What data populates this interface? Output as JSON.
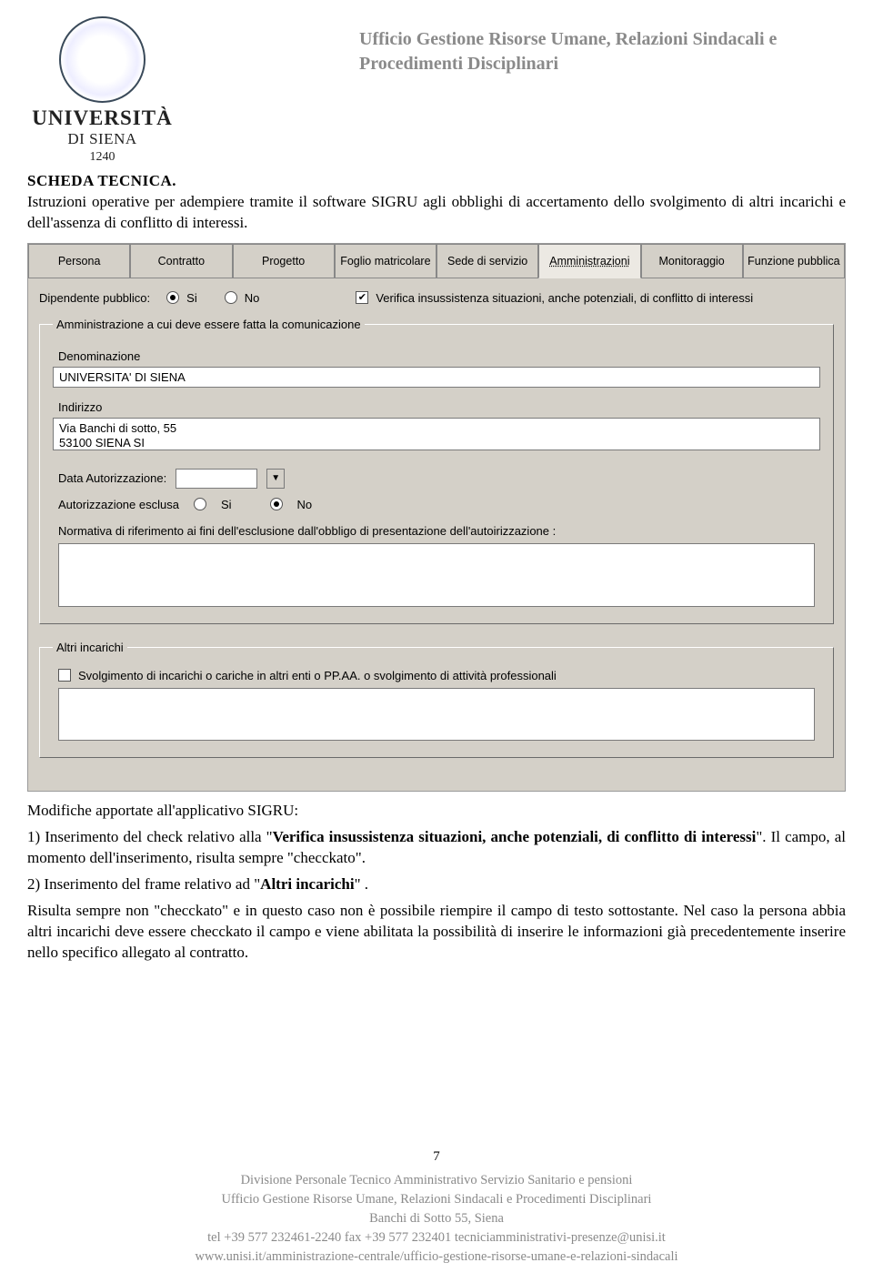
{
  "header": {
    "logo_uni": "UNIVERSITÀ",
    "logo_di_siena": "DI SIENA",
    "logo_year": "1240",
    "office_title": "Ufficio Gestione Risorse Umane, Relazioni Sindacali e Procedimenti Disciplinari"
  },
  "doc": {
    "scheda": "SCHEDA TECNICA.",
    "intro": "Istruzioni operative per adempiere tramite il software SIGRU agli obblighi di accertamento dello svolgimento di altri incarichi e dell'assenza di conflitto di interessi."
  },
  "app": {
    "tabs": [
      {
        "label": "Persona"
      },
      {
        "label": "Contratto"
      },
      {
        "label": "Progetto"
      },
      {
        "label": "Foglio matricolare"
      },
      {
        "label": "Sede di servizio"
      },
      {
        "label": "Amministrazioni"
      },
      {
        "label": "Monitoraggio"
      },
      {
        "label": "Funzione pubblica"
      }
    ],
    "dip_pubblico_label": "Dipendente pubblico:",
    "si": "Si",
    "no": "No",
    "verifica_label": "Verifica insussistenza situazioni, anche potenziali, di conflitto di interessi",
    "fieldset_admin": "Amministrazione a cui deve essere fatta la comunicazione",
    "denominazione_label": "Denominazione",
    "denominazione_value": "UNIVERSITA' DI SIENA",
    "indirizzo_label": "Indirizzo",
    "indirizzo_value": "Via Banchi di sotto, 55\n53100 SIENA SI",
    "data_auth_label": "Data Autorizzazione:",
    "auth_esclusa_label": "Autorizzazione esclusa",
    "norma_label": "Normativa di riferimento ai fini dell'esclusione dall'obbligo di presentazione dell'autoirizzazione :",
    "fieldset_altri": "Altri incarichi",
    "altri_check_label": "Svolgimento di incarichi o cariche in altri enti o PP.AA. o svolgimento di attività professionali"
  },
  "after": {
    "modifiche": "Modifiche apportate all'applicativo SIGRU:",
    "p1_a": "1) Inserimento del check relativo alla \"",
    "p1_bold": "Verifica insussistenza situazioni, anche potenziali, di conflitto di interessi",
    "p1_b": "\". Il campo, al momento dell'inserimento, risulta sempre \"checckato\".",
    "p2_a": "2) Inserimento del frame relativo ad \"",
    "p2_bold": "Altri incarichi",
    "p2_b": "\" .",
    "p3": "Risulta sempre non \"checckato\" e in questo caso non è possibile riempire il campo di testo sottostante. Nel caso la persona abbia altri incarichi deve essere checckato il campo e viene abilitata la possibilità di inserire le informazioni già precedentemente inserire nello specifico allegato al contratto."
  },
  "footer": {
    "page": "7",
    "l1": "Divisione Personale Tecnico Amministrativo Servizio Sanitario e pensioni",
    "l2": "Ufficio Gestione Risorse Umane, Relazioni Sindacali e Procedimenti Disciplinari",
    "l3": "Banchi di Sotto 55, Siena",
    "l4": "tel +39 577 232461-2240  fax +39 577 232401  tecniciamministrativi-presenze@unisi.it",
    "l5": "www.unisi.it/amministrazione-centrale/ufficio-gestione-risorse-umane-e-relazioni-sindacali"
  }
}
